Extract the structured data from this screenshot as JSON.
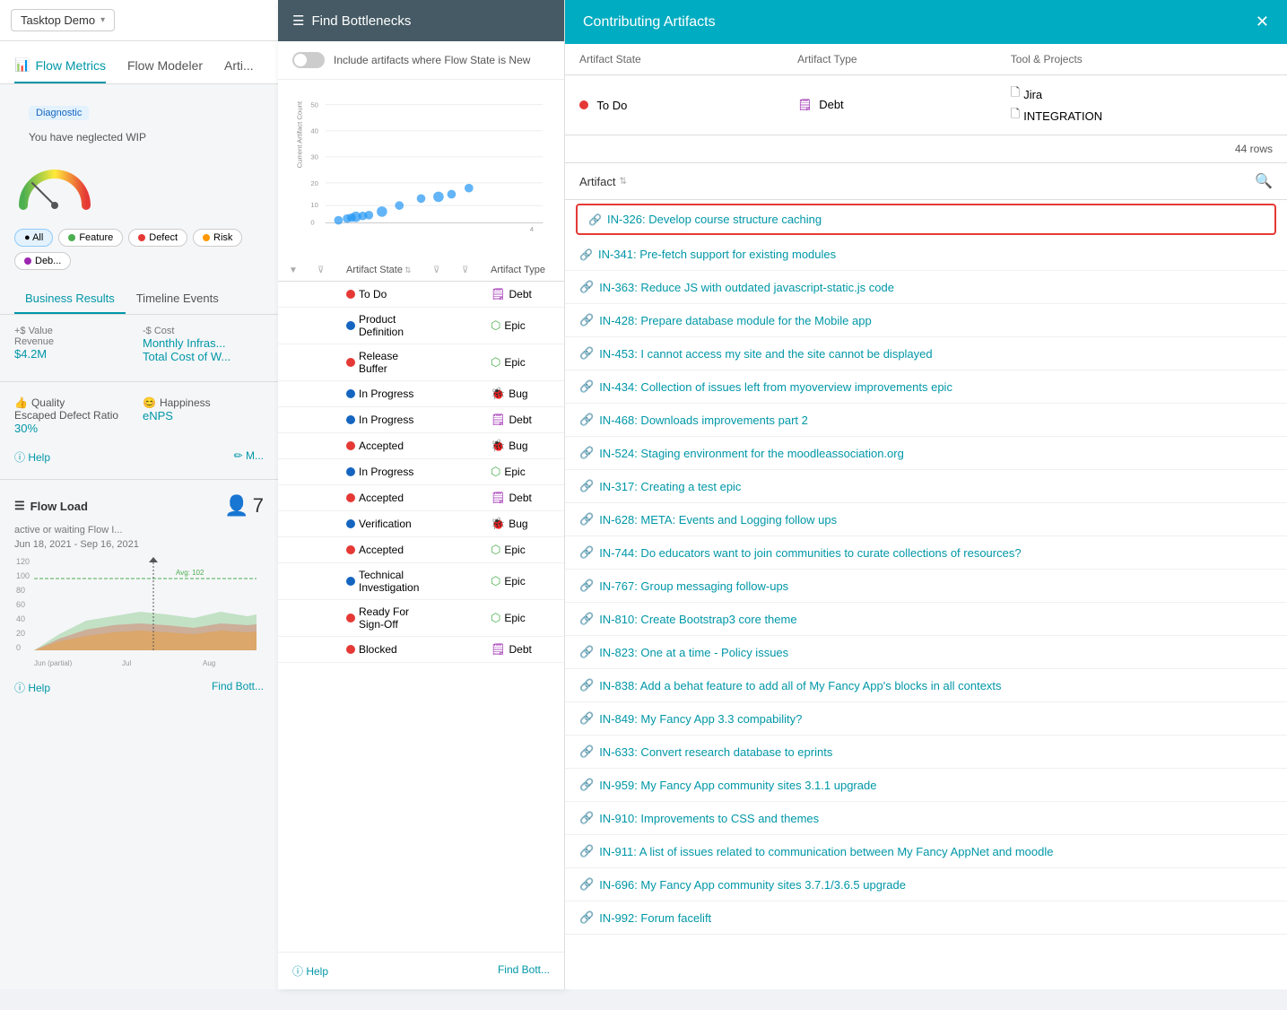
{
  "app": {
    "name": "Tasktop Demo",
    "nav_tabs": [
      {
        "label": "Flow Metrics",
        "icon": "📊",
        "active": true
      },
      {
        "label": "Flow Modeler",
        "icon": "🔧",
        "active": false
      },
      {
        "label": "Arti...",
        "icon": "",
        "active": false
      }
    ]
  },
  "left_panel": {
    "diagnostic_badge": "Diagnostic",
    "wip_text": "You have neglected WIP",
    "filter_chips": [
      {
        "label": "All",
        "active": true,
        "color": "#555"
      },
      {
        "label": "Feature",
        "active": false,
        "color": "#4caf50"
      },
      {
        "label": "Defect",
        "active": false,
        "color": "#e53935"
      },
      {
        "label": "Risk",
        "active": false,
        "color": "#ff9800"
      },
      {
        "label": "Deb...",
        "active": false,
        "color": "#9c27b0"
      }
    ],
    "sub_tabs": [
      {
        "label": "Business Results",
        "active": true
      },
      {
        "label": "Timeline Events",
        "active": false
      }
    ],
    "value_section": {
      "label": "+$ Value",
      "revenue_label": "Revenue",
      "revenue_value": "$4.2M"
    },
    "cost_section": {
      "label": "-$ Cost",
      "monthly_label": "Monthly Infras...",
      "total_label": "Total Cost of W..."
    },
    "quality_section": {
      "label": "Quality",
      "escaped_defect_label": "Escaped Defect Ratio",
      "escaped_defect_value": "30%",
      "happiness_label": "Happiness",
      "enps_label": "eNPS"
    },
    "flow_load": {
      "title": "Flow Load",
      "count": "7",
      "subtitle": "active or waiting Flow I...",
      "date_range": "Jun 18, 2021 - Sep 16, 2021",
      "avg_label": "Avg: 102",
      "y_axis": [
        120,
        100,
        80,
        60,
        40,
        20,
        0
      ],
      "x_labels": [
        "Jun (partial)",
        "Jul",
        "Aug"
      ]
    }
  },
  "middle_panel": {
    "title": "Find Bottlenecks",
    "toggle_label": "Include artifacts where Flow State is New",
    "toggle_on": false,
    "scatter_y_label": "Current Artifact Count",
    "scatter_x_label": "4",
    "scatter_y_values": [
      50,
      40,
      30,
      20,
      10,
      0
    ],
    "table_headers": {
      "artifact_state": "Artifact State",
      "artifact_type": "Artifact Type"
    },
    "rows": [
      {
        "state": "To Do",
        "dot": "red",
        "type": "Debt",
        "type_icon": "purple"
      },
      {
        "state": "Product Definition",
        "dot": "blue",
        "type": "Epic",
        "type_icon": "green"
      },
      {
        "state": "Release Buffer",
        "dot": "red",
        "type": "Epic",
        "type_icon": "green"
      },
      {
        "state": "In Progress",
        "dot": "blue",
        "type": "Bug",
        "type_icon": "red"
      },
      {
        "state": "In Progress",
        "dot": "blue",
        "type": "Debt",
        "type_icon": "purple"
      },
      {
        "state": "Accepted",
        "dot": "red",
        "type": "Bug",
        "type_icon": "red"
      },
      {
        "state": "In Progress",
        "dot": "blue",
        "type": "Epic",
        "type_icon": "green"
      },
      {
        "state": "Accepted",
        "dot": "red",
        "type": "Debt",
        "type_icon": "purple"
      },
      {
        "state": "Verification",
        "dot": "blue",
        "type": "Bug",
        "type_icon": "red"
      },
      {
        "state": "Accepted",
        "dot": "red",
        "type": "Epic",
        "type_icon": "green"
      },
      {
        "state": "Technical Investigation",
        "dot": "blue",
        "type": "Epic",
        "type_icon": "green"
      },
      {
        "state": "Ready For Sign-Off",
        "dot": "red",
        "type": "Epic",
        "type_icon": "green"
      },
      {
        "state": "Blocked",
        "dot": "red",
        "type": "Debt",
        "type_icon": "purple"
      }
    ]
  },
  "right_panel": {
    "title": "Contributing Artifacts",
    "filter_headers": [
      "Artifact State",
      "Artifact Type",
      "Tool & Projects"
    ],
    "filter_row": {
      "state": "To Do",
      "type": "Debt",
      "tool": "Jira",
      "project": "INTEGRATION"
    },
    "rows_count": "44 rows",
    "artifact_col_label": "Artifact",
    "artifacts": [
      {
        "id": "IN-326",
        "title": "Develop course structure caching",
        "highlighted": true
      },
      {
        "id": "IN-341",
        "title": "Pre-fetch support for existing modules",
        "highlighted": false
      },
      {
        "id": "IN-363",
        "title": "Reduce JS with outdated javascript-static.js code",
        "highlighted": false
      },
      {
        "id": "IN-428",
        "title": "Prepare database module for the Mobile app",
        "highlighted": false
      },
      {
        "id": "IN-453",
        "title": "I cannot access my site and the site cannot be displayed",
        "highlighted": false
      },
      {
        "id": "IN-434",
        "title": "Collection of issues left from myoverview improvements epic",
        "highlighted": false
      },
      {
        "id": "IN-468",
        "title": "Downloads improvements part 2",
        "highlighted": false
      },
      {
        "id": "IN-524",
        "title": "Staging environment for the moodleassociation.org",
        "highlighted": false
      },
      {
        "id": "IN-317",
        "title": "Creating a test epic",
        "highlighted": false
      },
      {
        "id": "IN-628",
        "title": "META: Events and Logging follow ups",
        "highlighted": false
      },
      {
        "id": "IN-744",
        "title": "Do educators want to join communities to curate collections of resources?",
        "highlighted": false
      },
      {
        "id": "IN-767",
        "title": "Group messaging follow-ups",
        "highlighted": false
      },
      {
        "id": "IN-810",
        "title": "Create Bootstrap3 core theme",
        "highlighted": false
      },
      {
        "id": "IN-823",
        "title": "One at a time - Policy issues",
        "highlighted": false
      },
      {
        "id": "IN-838",
        "title": "Add a behat feature to add all of My Fancy App's blocks in all contexts",
        "highlighted": false
      },
      {
        "id": "IN-849",
        "title": "My Fancy App 3.3 compability?",
        "highlighted": false
      },
      {
        "id": "IN-633",
        "title": "Convert research database to eprints",
        "highlighted": false
      },
      {
        "id": "IN-959",
        "title": "My Fancy App community sites 3.1.1 upgrade",
        "highlighted": false
      },
      {
        "id": "IN-910",
        "title": "Improvements to CSS and themes",
        "highlighted": false
      },
      {
        "id": "IN-911",
        "title": "A list of issues related to communication between My Fancy AppNet and moodle",
        "highlighted": false
      },
      {
        "id": "IN-696",
        "title": "My Fancy App community sites 3.7.1/3.6.5 upgrade",
        "highlighted": false
      },
      {
        "id": "IN-992",
        "title": "Forum facelift",
        "highlighted": false
      }
    ]
  },
  "colors": {
    "teal": "#0097a7",
    "dark_teal": "#00acc1",
    "slate": "#455a64",
    "red": "#e53935",
    "blue": "#1565c0",
    "green": "#388e3c"
  }
}
